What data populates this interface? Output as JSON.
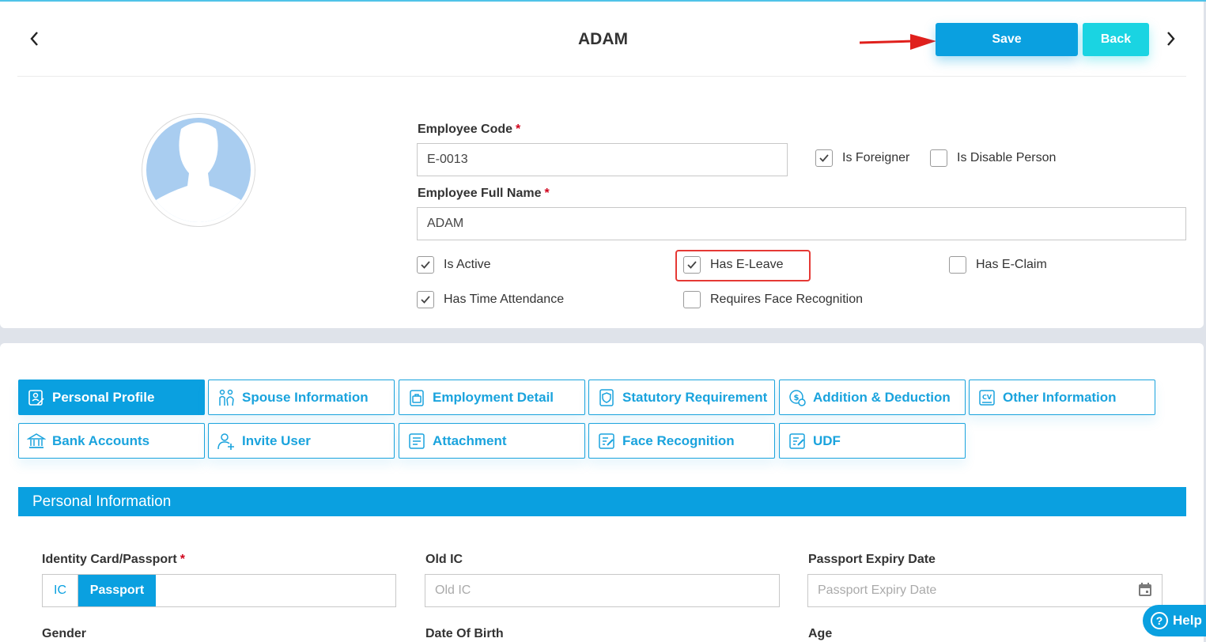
{
  "header": {
    "title": "ADAM",
    "save_label": "Save",
    "back_label": "Back"
  },
  "employee": {
    "code_label": "Employee Code",
    "code_required": "*",
    "code_value": "E-0013",
    "name_label": "Employee Full Name",
    "name_required": "*",
    "name_value": "ADAM"
  },
  "flags": {
    "is_foreigner": {
      "label": "Is Foreigner",
      "checked": true
    },
    "is_disable_person": {
      "label": "Is Disable Person",
      "checked": false
    },
    "is_active": {
      "label": "Is Active",
      "checked": true
    },
    "has_e_leave": {
      "label": "Has E-Leave",
      "checked": true
    },
    "has_e_claim": {
      "label": "Has E-Claim",
      "checked": false
    },
    "has_time_attendance": {
      "label": "Has Time Attendance",
      "checked": true
    },
    "requires_face_recognition": {
      "label": "Requires Face Recognition",
      "checked": false
    }
  },
  "tabs": [
    {
      "label": "Personal Profile",
      "icon": "profile-icon",
      "active": true
    },
    {
      "label": "Spouse Information",
      "icon": "spouse-icon",
      "active": false
    },
    {
      "label": "Employment Detail",
      "icon": "briefcase-icon",
      "active": false
    },
    {
      "label": "Statutory Requirement",
      "icon": "statutory-icon",
      "active": false
    },
    {
      "label": "Addition & Deduction",
      "icon": "money-icon",
      "active": false
    },
    {
      "label": "Other Information",
      "icon": "cv-icon",
      "active": false
    },
    {
      "label": "Bank Accounts",
      "icon": "bank-icon",
      "active": false
    },
    {
      "label": "Invite User",
      "icon": "invite-user-icon",
      "active": false
    },
    {
      "label": "Attachment",
      "icon": "document-icon",
      "active": false
    },
    {
      "label": "Face Recognition",
      "icon": "document-edit-icon",
      "active": false
    },
    {
      "label": "UDF",
      "icon": "document-edit-icon",
      "active": false
    }
  ],
  "section": {
    "title": "Personal Information"
  },
  "personal": {
    "identity_label": "Identity Card/Passport",
    "identity_required": "*",
    "identity_options": [
      "IC",
      "Passport"
    ],
    "identity_selected": "Passport",
    "old_ic_label": "Old IC",
    "old_ic_placeholder": "Old IC",
    "passport_expiry_label": "Passport Expiry Date",
    "passport_expiry_placeholder": "Passport Expiry Date",
    "gender_label": "Gender",
    "dob_label": "Date Of Birth",
    "age_label": "Age"
  },
  "help": {
    "label": "Help"
  },
  "colors": {
    "primary": "#0aa0e0",
    "back_button": "#1ad4e2",
    "highlight_border": "#e53935",
    "required_mark": "#d0021b"
  }
}
